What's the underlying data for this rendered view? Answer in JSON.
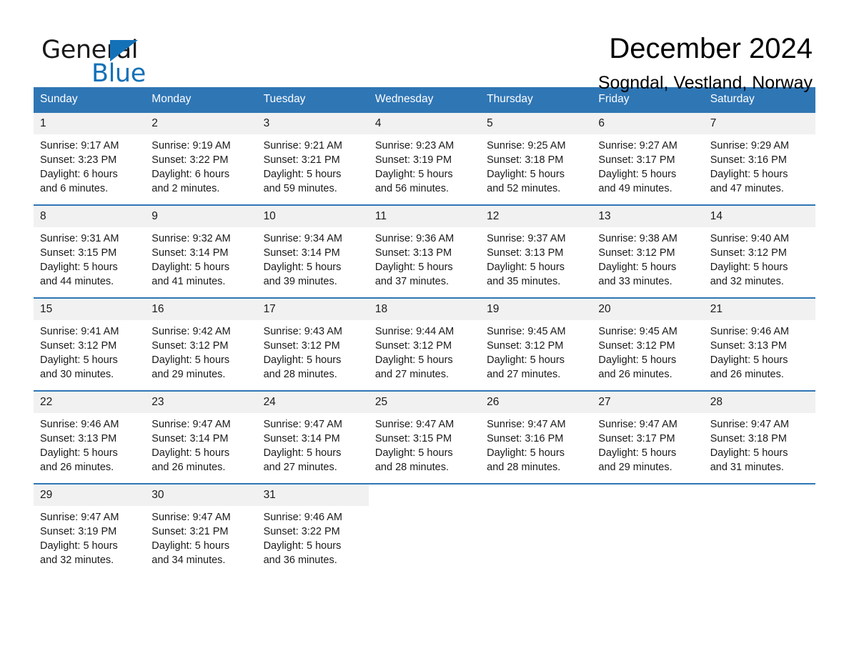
{
  "brand": {
    "name_part1": "General",
    "name_part2": "Blue",
    "triangle_icon": "blue-triangle-icon",
    "accent_color": "#1371b8"
  },
  "header": {
    "title": "December 2024",
    "subtitle": "Sogndal, Vestland, Norway"
  },
  "calendar": {
    "header_bg": "#2f76b5",
    "daynum_bg": "#f1f1f1",
    "weekdays": [
      "Sunday",
      "Monday",
      "Tuesday",
      "Wednesday",
      "Thursday",
      "Friday",
      "Saturday"
    ],
    "weeks": [
      [
        {
          "day": "1",
          "sunrise": "Sunrise: 9:17 AM",
          "sunset": "Sunset: 3:23 PM",
          "daylight_line1": "Daylight: 6 hours",
          "daylight_line2": "and 6 minutes."
        },
        {
          "day": "2",
          "sunrise": "Sunrise: 9:19 AM",
          "sunset": "Sunset: 3:22 PM",
          "daylight_line1": "Daylight: 6 hours",
          "daylight_line2": "and 2 minutes."
        },
        {
          "day": "3",
          "sunrise": "Sunrise: 9:21 AM",
          "sunset": "Sunset: 3:21 PM",
          "daylight_line1": "Daylight: 5 hours",
          "daylight_line2": "and 59 minutes."
        },
        {
          "day": "4",
          "sunrise": "Sunrise: 9:23 AM",
          "sunset": "Sunset: 3:19 PM",
          "daylight_line1": "Daylight: 5 hours",
          "daylight_line2": "and 56 minutes."
        },
        {
          "day": "5",
          "sunrise": "Sunrise: 9:25 AM",
          "sunset": "Sunset: 3:18 PM",
          "daylight_line1": "Daylight: 5 hours",
          "daylight_line2": "and 52 minutes."
        },
        {
          "day": "6",
          "sunrise": "Sunrise: 9:27 AM",
          "sunset": "Sunset: 3:17 PM",
          "daylight_line1": "Daylight: 5 hours",
          "daylight_line2": "and 49 minutes."
        },
        {
          "day": "7",
          "sunrise": "Sunrise: 9:29 AM",
          "sunset": "Sunset: 3:16 PM",
          "daylight_line1": "Daylight: 5 hours",
          "daylight_line2": "and 47 minutes."
        }
      ],
      [
        {
          "day": "8",
          "sunrise": "Sunrise: 9:31 AM",
          "sunset": "Sunset: 3:15 PM",
          "daylight_line1": "Daylight: 5 hours",
          "daylight_line2": "and 44 minutes."
        },
        {
          "day": "9",
          "sunrise": "Sunrise: 9:32 AM",
          "sunset": "Sunset: 3:14 PM",
          "daylight_line1": "Daylight: 5 hours",
          "daylight_line2": "and 41 minutes."
        },
        {
          "day": "10",
          "sunrise": "Sunrise: 9:34 AM",
          "sunset": "Sunset: 3:14 PM",
          "daylight_line1": "Daylight: 5 hours",
          "daylight_line2": "and 39 minutes."
        },
        {
          "day": "11",
          "sunrise": "Sunrise: 9:36 AM",
          "sunset": "Sunset: 3:13 PM",
          "daylight_line1": "Daylight: 5 hours",
          "daylight_line2": "and 37 minutes."
        },
        {
          "day": "12",
          "sunrise": "Sunrise: 9:37 AM",
          "sunset": "Sunset: 3:13 PM",
          "daylight_line1": "Daylight: 5 hours",
          "daylight_line2": "and 35 minutes."
        },
        {
          "day": "13",
          "sunrise": "Sunrise: 9:38 AM",
          "sunset": "Sunset: 3:12 PM",
          "daylight_line1": "Daylight: 5 hours",
          "daylight_line2": "and 33 minutes."
        },
        {
          "day": "14",
          "sunrise": "Sunrise: 9:40 AM",
          "sunset": "Sunset: 3:12 PM",
          "daylight_line1": "Daylight: 5 hours",
          "daylight_line2": "and 32 minutes."
        }
      ],
      [
        {
          "day": "15",
          "sunrise": "Sunrise: 9:41 AM",
          "sunset": "Sunset: 3:12 PM",
          "daylight_line1": "Daylight: 5 hours",
          "daylight_line2": "and 30 minutes."
        },
        {
          "day": "16",
          "sunrise": "Sunrise: 9:42 AM",
          "sunset": "Sunset: 3:12 PM",
          "daylight_line1": "Daylight: 5 hours",
          "daylight_line2": "and 29 minutes."
        },
        {
          "day": "17",
          "sunrise": "Sunrise: 9:43 AM",
          "sunset": "Sunset: 3:12 PM",
          "daylight_line1": "Daylight: 5 hours",
          "daylight_line2": "and 28 minutes."
        },
        {
          "day": "18",
          "sunrise": "Sunrise: 9:44 AM",
          "sunset": "Sunset: 3:12 PM",
          "daylight_line1": "Daylight: 5 hours",
          "daylight_line2": "and 27 minutes."
        },
        {
          "day": "19",
          "sunrise": "Sunrise: 9:45 AM",
          "sunset": "Sunset: 3:12 PM",
          "daylight_line1": "Daylight: 5 hours",
          "daylight_line2": "and 27 minutes."
        },
        {
          "day": "20",
          "sunrise": "Sunrise: 9:45 AM",
          "sunset": "Sunset: 3:12 PM",
          "daylight_line1": "Daylight: 5 hours",
          "daylight_line2": "and 26 minutes."
        },
        {
          "day": "21",
          "sunrise": "Sunrise: 9:46 AM",
          "sunset": "Sunset: 3:13 PM",
          "daylight_line1": "Daylight: 5 hours",
          "daylight_line2": "and 26 minutes."
        }
      ],
      [
        {
          "day": "22",
          "sunrise": "Sunrise: 9:46 AM",
          "sunset": "Sunset: 3:13 PM",
          "daylight_line1": "Daylight: 5 hours",
          "daylight_line2": "and 26 minutes."
        },
        {
          "day": "23",
          "sunrise": "Sunrise: 9:47 AM",
          "sunset": "Sunset: 3:14 PM",
          "daylight_line1": "Daylight: 5 hours",
          "daylight_line2": "and 26 minutes."
        },
        {
          "day": "24",
          "sunrise": "Sunrise: 9:47 AM",
          "sunset": "Sunset: 3:14 PM",
          "daylight_line1": "Daylight: 5 hours",
          "daylight_line2": "and 27 minutes."
        },
        {
          "day": "25",
          "sunrise": "Sunrise: 9:47 AM",
          "sunset": "Sunset: 3:15 PM",
          "daylight_line1": "Daylight: 5 hours",
          "daylight_line2": "and 28 minutes."
        },
        {
          "day": "26",
          "sunrise": "Sunrise: 9:47 AM",
          "sunset": "Sunset: 3:16 PM",
          "daylight_line1": "Daylight: 5 hours",
          "daylight_line2": "and 28 minutes."
        },
        {
          "day": "27",
          "sunrise": "Sunrise: 9:47 AM",
          "sunset": "Sunset: 3:17 PM",
          "daylight_line1": "Daylight: 5 hours",
          "daylight_line2": "and 29 minutes."
        },
        {
          "day": "28",
          "sunrise": "Sunrise: 9:47 AM",
          "sunset": "Sunset: 3:18 PM",
          "daylight_line1": "Daylight: 5 hours",
          "daylight_line2": "and 31 minutes."
        }
      ],
      [
        {
          "day": "29",
          "sunrise": "Sunrise: 9:47 AM",
          "sunset": "Sunset: 3:19 PM",
          "daylight_line1": "Daylight: 5 hours",
          "daylight_line2": "and 32 minutes."
        },
        {
          "day": "30",
          "sunrise": "Sunrise: 9:47 AM",
          "sunset": "Sunset: 3:21 PM",
          "daylight_line1": "Daylight: 5 hours",
          "daylight_line2": "and 34 minutes."
        },
        {
          "day": "31",
          "sunrise": "Sunrise: 9:46 AM",
          "sunset": "Sunset: 3:22 PM",
          "daylight_line1": "Daylight: 5 hours",
          "daylight_line2": "and 36 minutes."
        },
        {
          "day": "",
          "sunrise": "",
          "sunset": "",
          "daylight_line1": "",
          "daylight_line2": ""
        },
        {
          "day": "",
          "sunrise": "",
          "sunset": "",
          "daylight_line1": "",
          "daylight_line2": ""
        },
        {
          "day": "",
          "sunrise": "",
          "sunset": "",
          "daylight_line1": "",
          "daylight_line2": ""
        },
        {
          "day": "",
          "sunrise": "",
          "sunset": "",
          "daylight_line1": "",
          "daylight_line2": ""
        }
      ]
    ]
  }
}
